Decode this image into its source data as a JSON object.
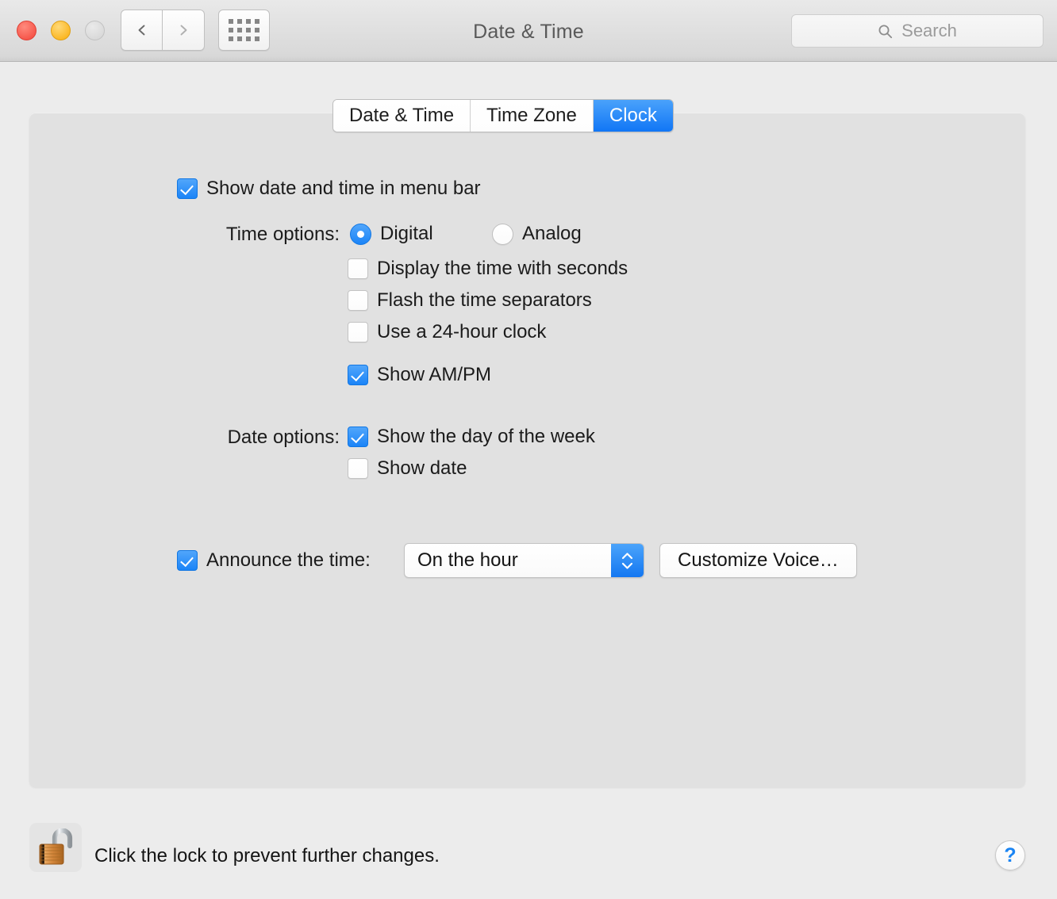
{
  "window": {
    "title": "Date & Time",
    "traffic_lights": [
      {
        "name": "close",
        "color": "#f6564a"
      },
      {
        "name": "minimize",
        "color": "#fbb724"
      },
      {
        "name": "zoom",
        "color": "#d9d9d9"
      }
    ],
    "nav": {
      "back_icon": "chevron-left-icon",
      "forward_icon": "chevron-right-icon",
      "grid_icon": "show-all-grid-icon"
    },
    "search": {
      "placeholder": "Search",
      "value": "",
      "icon": "search-icon"
    }
  },
  "tabs": [
    {
      "label": "Date & Time",
      "selected": false
    },
    {
      "label": "Time Zone",
      "selected": false
    },
    {
      "label": "Clock",
      "selected": true
    }
  ],
  "main": {
    "show_in_menu_bar": {
      "label": "Show date and time in menu bar",
      "checked": true
    },
    "time_options": {
      "label": "Time options:",
      "radios": [
        {
          "label": "Digital",
          "selected": true
        },
        {
          "label": "Analog",
          "selected": false
        }
      ],
      "checkboxes": [
        {
          "label": "Display the time with seconds",
          "checked": false
        },
        {
          "label": "Flash the time separators",
          "checked": false
        },
        {
          "label": "Use a 24-hour clock",
          "checked": false
        },
        {
          "label": "Show AM/PM",
          "checked": true
        }
      ]
    },
    "date_options": {
      "label": "Date options:",
      "checkboxes": [
        {
          "label": "Show the day of the week",
          "checked": true
        },
        {
          "label": "Show date",
          "checked": false
        }
      ]
    },
    "announce": {
      "label": "Announce the time:",
      "checked": true,
      "interval_value": "On the hour",
      "customize_button": "Customize Voice…"
    }
  },
  "footer": {
    "lock_icon": "unlocked-padlock-icon",
    "lock_message": "Click the lock to prevent further changes.",
    "help_label": "?"
  },
  "colors": {
    "accent_blue": "#1b84f7",
    "window_bg": "#ececec",
    "panel_bg": "#e1e1e1"
  }
}
